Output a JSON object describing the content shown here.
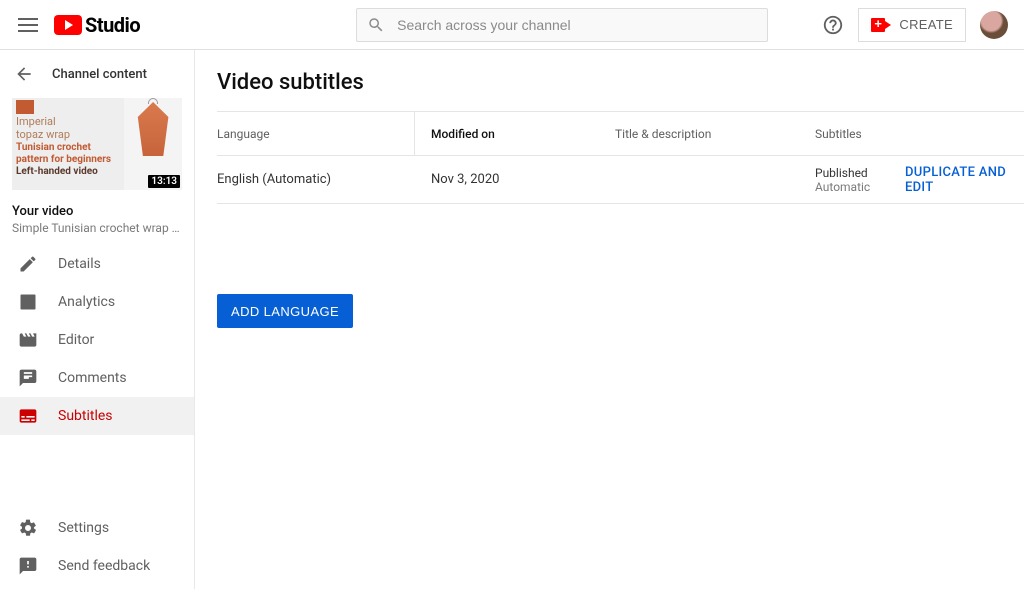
{
  "header": {
    "logo_text": "Studio",
    "search_placeholder": "Search across your channel",
    "create_label": "CREATE"
  },
  "sidebar": {
    "back_label": "Channel content",
    "thumb": {
      "line1": "Imperial",
      "line2": "topaz wrap",
      "line3": "Tunisian crochet",
      "line4": "pattern for beginners",
      "line5": "Left-handed video",
      "duration": "13:13"
    },
    "video_section_label": "Your video",
    "video_title": "Simple Tunisian crochet wrap with g…",
    "nav": [
      {
        "label": "Details"
      },
      {
        "label": "Analytics"
      },
      {
        "label": "Editor"
      },
      {
        "label": "Comments"
      },
      {
        "label": "Subtitles"
      }
    ],
    "bottom": [
      {
        "label": "Settings"
      },
      {
        "label": "Send feedback"
      }
    ]
  },
  "main": {
    "title": "Video subtitles",
    "headers": {
      "language": "Language",
      "modified": "Modified on",
      "title_desc": "Title & description",
      "subtitles": "Subtitles"
    },
    "rows": [
      {
        "language": "English (Automatic)",
        "modified": "Nov 3, 2020",
        "title_desc": "",
        "sub_top": "Published",
        "sub_bot": "Automatic",
        "action": "DUPLICATE AND EDIT"
      }
    ],
    "add_language": "ADD LANGUAGE"
  }
}
